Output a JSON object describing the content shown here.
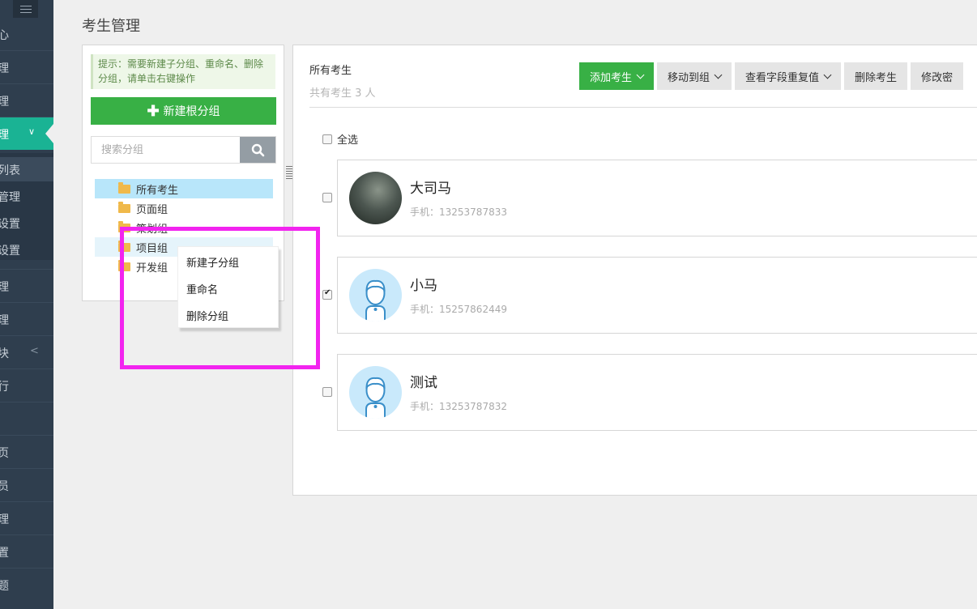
{
  "sidebar": {
    "items": [
      {
        "label": "心"
      },
      {
        "label": "理"
      },
      {
        "label": "理"
      },
      {
        "label": "理"
      },
      {
        "label": "列表"
      },
      {
        "label": "管理"
      },
      {
        "label": "设置"
      },
      {
        "label": "设置"
      },
      {
        "label": "理"
      },
      {
        "label": "理"
      },
      {
        "label": "块"
      },
      {
        "label": "行"
      },
      {
        "label": "页"
      },
      {
        "label": "员"
      },
      {
        "label": "理"
      },
      {
        "label": "置"
      },
      {
        "label": "题"
      }
    ],
    "active_color": "#1ab394",
    "background": "#2f3e4e"
  },
  "page": {
    "title": "考生管理"
  },
  "left_panel": {
    "tip": "提示：需要新建子分组、重命名、删除分组，请单击右键操作",
    "new_root_button": "新建根分组",
    "search_placeholder": "搜索分组",
    "tree": [
      {
        "label": "所有考生",
        "selected": true
      },
      {
        "label": "页面组"
      },
      {
        "label": "策划组"
      },
      {
        "label": "项目组",
        "hovered": true
      },
      {
        "label": "开发组"
      }
    ]
  },
  "context_menu": {
    "items": [
      "新建子分组",
      "重命名",
      "删除分组"
    ]
  },
  "right_panel": {
    "title": "所有考生",
    "count_text": "共有考生 3 人",
    "toolbar": {
      "add": "添加考生",
      "move": "移动到组",
      "check_dup": "查看字段重复值",
      "delete": "删除考生",
      "modify": "修改密"
    },
    "select_all": "全选",
    "students": [
      {
        "name": "大司马",
        "phone": "手机：13253787833",
        "checked": false,
        "avatar": "photo"
      },
      {
        "name": "小马",
        "phone": "手机：15257862449",
        "checked": true,
        "avatar": "default"
      },
      {
        "name": "测试",
        "phone": "手机：13253787832",
        "checked": false,
        "avatar": "default"
      }
    ]
  },
  "colors": {
    "primary_green": "#38b045",
    "highlight_magenta": "#f224ef",
    "tree_selected": "#b8e6fa"
  }
}
